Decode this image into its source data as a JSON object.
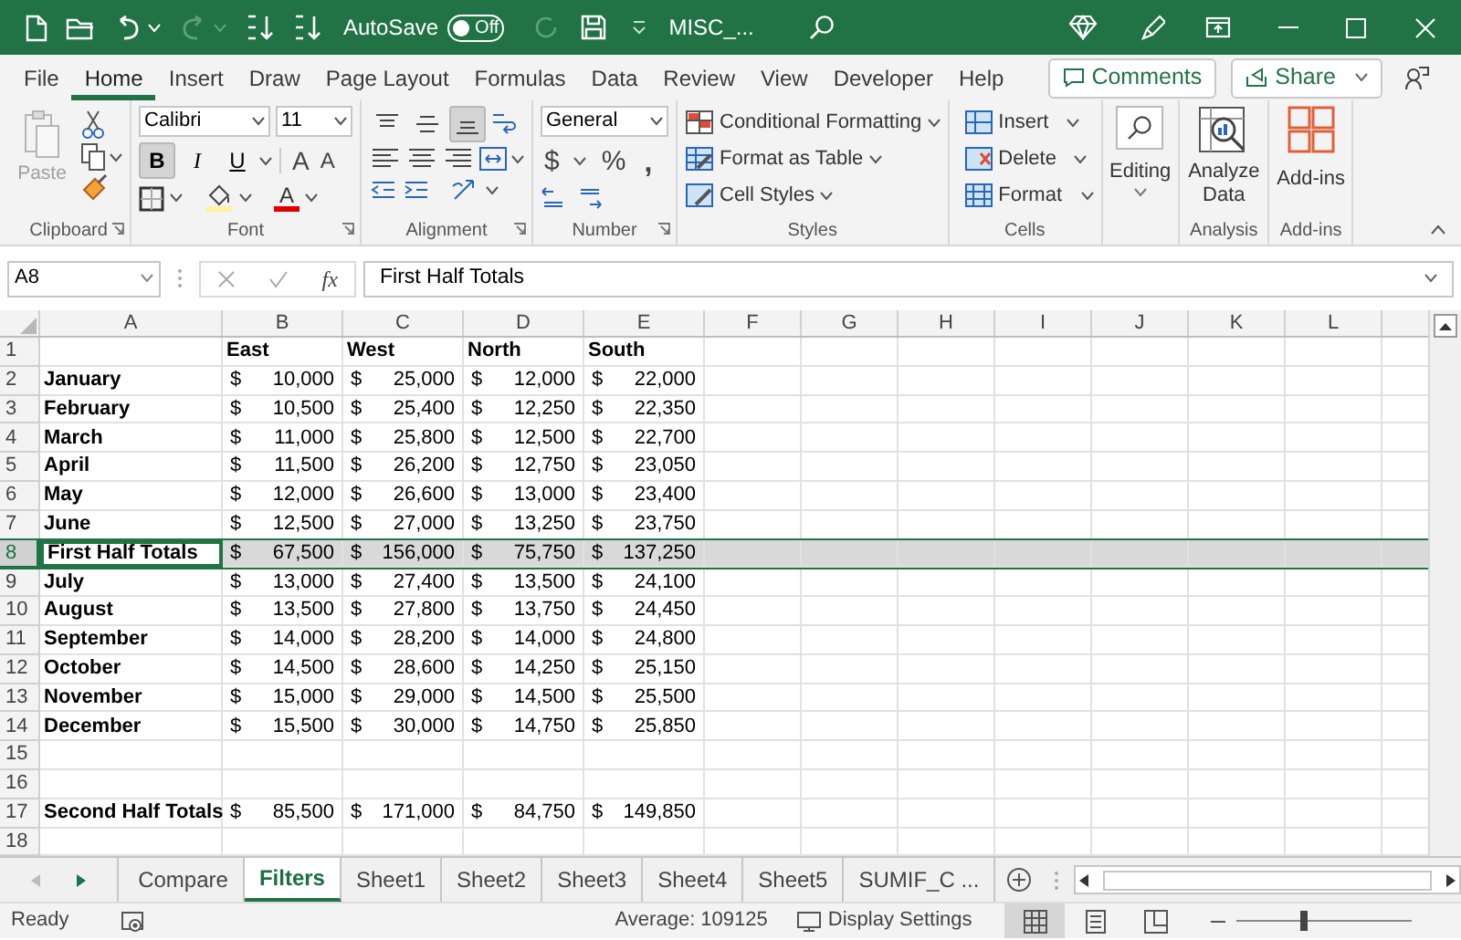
{
  "title_bar": {
    "autosave": {
      "label": "AutoSave",
      "on": false,
      "state_label": "Off"
    },
    "filename": "MISC_..."
  },
  "ribbon_tabs": [
    {
      "label": "File",
      "selected": false
    },
    {
      "label": "Home",
      "selected": true
    },
    {
      "label": "Insert",
      "selected": false
    },
    {
      "label": "Draw",
      "selected": false
    },
    {
      "label": "Page Layout",
      "selected": false
    },
    {
      "label": "Formulas",
      "selected": false
    },
    {
      "label": "Data",
      "selected": false
    },
    {
      "label": "Review",
      "selected": false
    },
    {
      "label": "View",
      "selected": false
    },
    {
      "label": "Developer",
      "selected": false
    },
    {
      "label": "Help",
      "selected": false
    }
  ],
  "comments_button": "Comments",
  "share_button": "Share",
  "clipboard": {
    "label": "Clipboard",
    "paste": "Paste"
  },
  "font": {
    "label": "Font",
    "font_name": "Calibri",
    "font_size": "11",
    "style_buttons": [
      {
        "label": "B",
        "pressed": true
      },
      {
        "label": "I",
        "pressed": false
      },
      {
        "label": "U",
        "pressed": false
      }
    ],
    "grow_font": "A",
    "shrink_font": "A",
    "font_color": "A"
  },
  "alignment": {
    "label": "Alignment",
    "vertical": [
      {
        "kind": "top",
        "pressed": false
      },
      {
        "kind": "middle",
        "pressed": false
      },
      {
        "kind": "bottom",
        "pressed": true
      }
    ]
  },
  "number": {
    "label": "Number",
    "format": "General",
    "buttons": [
      "$",
      "%",
      ","
    ]
  },
  "styles": {
    "label": "Styles",
    "items": [
      {
        "kind": "conditional",
        "label": "Conditional Formatting"
      },
      {
        "kind": "table",
        "label": "Format as Table"
      },
      {
        "kind": "cellstyles",
        "label": "Cell Styles"
      }
    ]
  },
  "cells": {
    "label": "Cells",
    "items": [
      {
        "kind": "insert",
        "label": "Insert"
      },
      {
        "kind": "delete",
        "label": "Delete"
      },
      {
        "kind": "format",
        "label": "Format"
      }
    ]
  },
  "editing": {
    "label": "Editing"
  },
  "analysis": {
    "label": "Analysis",
    "button": "Analyze Data"
  },
  "addins": {
    "label": "Add-ins",
    "button": "Add-ins"
  },
  "formula_bar": {
    "name_box": "A8",
    "function_button": "fx",
    "value": "First Half Totals"
  },
  "columns": [
    {
      "letter": "A"
    },
    {
      "letter": "B"
    },
    {
      "letter": "C"
    },
    {
      "letter": "D"
    },
    {
      "letter": "E"
    },
    {
      "letter": "F"
    },
    {
      "letter": "G"
    },
    {
      "letter": "H"
    },
    {
      "letter": "I"
    },
    {
      "letter": "J"
    },
    {
      "letter": "K"
    },
    {
      "letter": "L"
    }
  ],
  "rows": [
    {
      "number": "1",
      "selected": false,
      "kind": "header",
      "headings": [
        "East",
        "West",
        "North",
        "South"
      ]
    },
    {
      "number": "2",
      "selected": false,
      "kind": "data",
      "label": "January",
      "values": [
        {
          "currency": "$",
          "amount": "10,000"
        },
        {
          "currency": "$",
          "amount": "25,000"
        },
        {
          "currency": "$",
          "amount": "12,000"
        },
        {
          "currency": "$",
          "amount": "22,000"
        }
      ]
    },
    {
      "number": "3",
      "selected": false,
      "kind": "data",
      "label": "February",
      "values": [
        {
          "currency": "$",
          "amount": "10,500"
        },
        {
          "currency": "$",
          "amount": "25,400"
        },
        {
          "currency": "$",
          "amount": "12,250"
        },
        {
          "currency": "$",
          "amount": "22,350"
        }
      ]
    },
    {
      "number": "4",
      "selected": false,
      "kind": "data",
      "label": "March",
      "values": [
        {
          "currency": "$",
          "amount": "11,000"
        },
        {
          "currency": "$",
          "amount": "25,800"
        },
        {
          "currency": "$",
          "amount": "12,500"
        },
        {
          "currency": "$",
          "amount": "22,700"
        }
      ]
    },
    {
      "number": "5",
      "selected": false,
      "kind": "data",
      "label": "April",
      "values": [
        {
          "currency": "$",
          "amount": "11,500"
        },
        {
          "currency": "$",
          "amount": "26,200"
        },
        {
          "currency": "$",
          "amount": "12,750"
        },
        {
          "currency": "$",
          "amount": "23,050"
        }
      ]
    },
    {
      "number": "6",
      "selected": false,
      "kind": "data",
      "label": "May",
      "values": [
        {
          "currency": "$",
          "amount": "12,000"
        },
        {
          "currency": "$",
          "amount": "26,600"
        },
        {
          "currency": "$",
          "amount": "13,000"
        },
        {
          "currency": "$",
          "amount": "23,400"
        }
      ]
    },
    {
      "number": "7",
      "selected": false,
      "kind": "data",
      "label": "June",
      "values": [
        {
          "currency": "$",
          "amount": "12,500"
        },
        {
          "currency": "$",
          "amount": "27,000"
        },
        {
          "currency": "$",
          "amount": "13,250"
        },
        {
          "currency": "$",
          "amount": "23,750"
        }
      ]
    },
    {
      "number": "8",
      "selected": true,
      "kind": "data",
      "label": "First Half Totals",
      "values": [
        {
          "currency": "$",
          "amount": "67,500"
        },
        {
          "currency": "$",
          "amount": "156,000"
        },
        {
          "currency": "$",
          "amount": "75,750"
        },
        {
          "currency": "$",
          "amount": "137,250"
        }
      ]
    },
    {
      "number": "9",
      "selected": false,
      "kind": "data",
      "label": "July",
      "values": [
        {
          "currency": "$",
          "amount": "13,000"
        },
        {
          "currency": "$",
          "amount": "27,400"
        },
        {
          "currency": "$",
          "amount": "13,500"
        },
        {
          "currency": "$",
          "amount": "24,100"
        }
      ]
    },
    {
      "number": "10",
      "selected": false,
      "kind": "data",
      "label": "August",
      "values": [
        {
          "currency": "$",
          "amount": "13,500"
        },
        {
          "currency": "$",
          "amount": "27,800"
        },
        {
          "currency": "$",
          "amount": "13,750"
        },
        {
          "currency": "$",
          "amount": "24,450"
        }
      ]
    },
    {
      "number": "11",
      "selected": false,
      "kind": "data",
      "label": "September",
      "values": [
        {
          "currency": "$",
          "amount": "14,000"
        },
        {
          "currency": "$",
          "amount": "28,200"
        },
        {
          "currency": "$",
          "amount": "14,000"
        },
        {
          "currency": "$",
          "amount": "24,800"
        }
      ]
    },
    {
      "number": "12",
      "selected": false,
      "kind": "data",
      "label": "October",
      "values": [
        {
          "currency": "$",
          "amount": "14,500"
        },
        {
          "currency": "$",
          "amount": "28,600"
        },
        {
          "currency": "$",
          "amount": "14,250"
        },
        {
          "currency": "$",
          "amount": "25,150"
        }
      ]
    },
    {
      "number": "13",
      "selected": false,
      "kind": "data",
      "label": "November",
      "values": [
        {
          "currency": "$",
          "amount": "15,000"
        },
        {
          "currency": "$",
          "amount": "29,000"
        },
        {
          "currency": "$",
          "amount": "14,500"
        },
        {
          "currency": "$",
          "amount": "25,500"
        }
      ]
    },
    {
      "number": "14",
      "selected": false,
      "kind": "data",
      "label": "December",
      "values": [
        {
          "currency": "$",
          "amount": "15,500"
        },
        {
          "currency": "$",
          "amount": "30,000"
        },
        {
          "currency": "$",
          "amount": "14,750"
        },
        {
          "currency": "$",
          "amount": "25,850"
        }
      ]
    },
    {
      "number": "15",
      "selected": false,
      "kind": "blank"
    },
    {
      "number": "16",
      "selected": false,
      "kind": "blank"
    },
    {
      "number": "17",
      "selected": false,
      "kind": "data",
      "label": "Second Half Totals",
      "values": [
        {
          "currency": "$",
          "amount": "85,500"
        },
        {
          "currency": "$",
          "amount": "171,000"
        },
        {
          "currency": "$",
          "amount": "84,750"
        },
        {
          "currency": "$",
          "amount": "149,850"
        }
      ]
    },
    {
      "number": "18",
      "selected": false,
      "kind": "blank"
    }
  ],
  "sheet_tabs": [
    {
      "label": "Compare",
      "selected": false
    },
    {
      "label": "Filters",
      "selected": true
    },
    {
      "label": "Sheet1",
      "selected": false
    },
    {
      "label": "Sheet2",
      "selected": false
    },
    {
      "label": "Sheet3",
      "selected": false
    },
    {
      "label": "Sheet4",
      "selected": false
    },
    {
      "label": "Sheet5",
      "selected": false
    },
    {
      "label": "SUMIF_C ...",
      "selected": false
    }
  ],
  "status_bar": {
    "mode": "Ready",
    "average": "Average: 109125",
    "display_settings": "Display Settings",
    "views": [
      {
        "kind": "normal",
        "selected": true
      },
      {
        "kind": "page_layout",
        "selected": false
      },
      {
        "kind": "page_break",
        "selected": false
      }
    ],
    "zoom": {
      "level": 0.38
    }
  }
}
